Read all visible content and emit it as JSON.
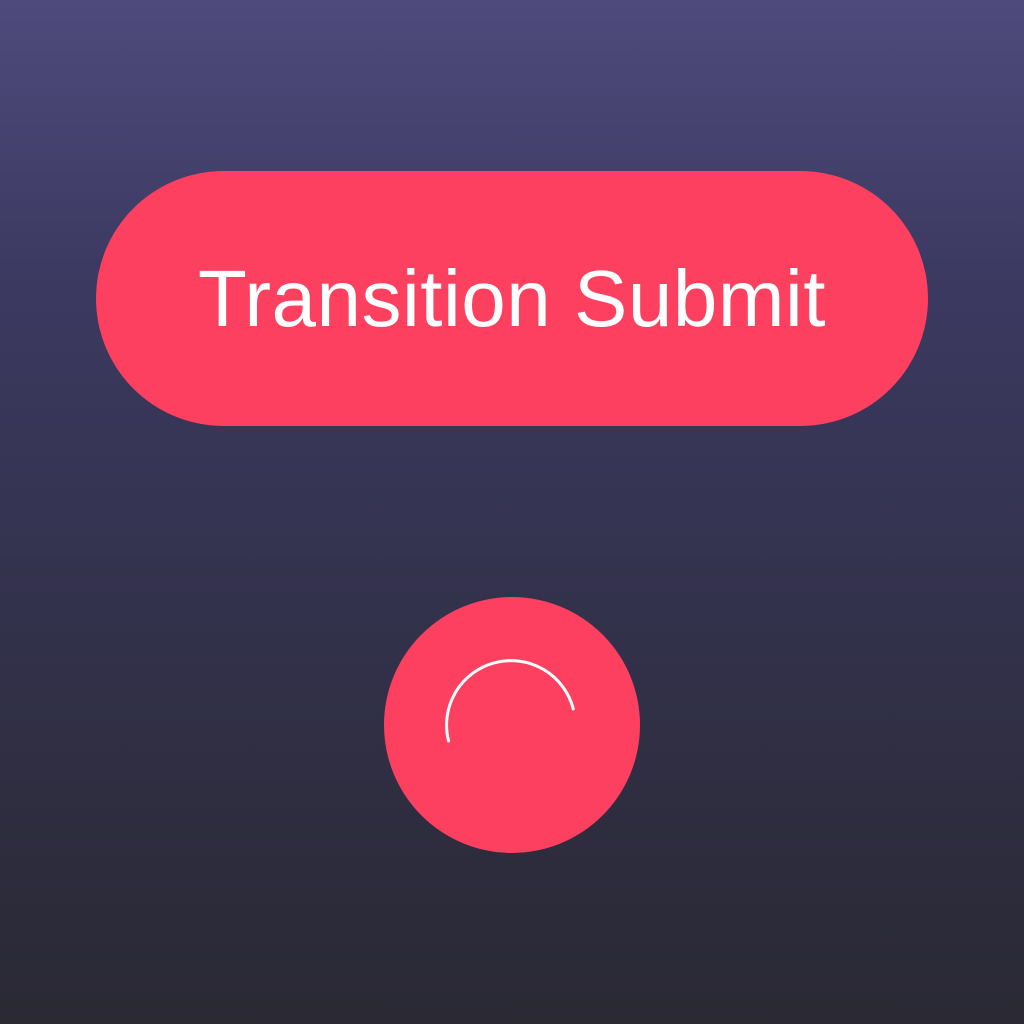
{
  "submit_button": {
    "label": "Transition Submit"
  },
  "loading_button": {
    "spinner_icon": "spinner-arc-icon"
  },
  "colors": {
    "accent": "#fd405f",
    "background_top": "#4e4a7c",
    "background_bottom": "#2a2934",
    "text": "#ffffff"
  }
}
